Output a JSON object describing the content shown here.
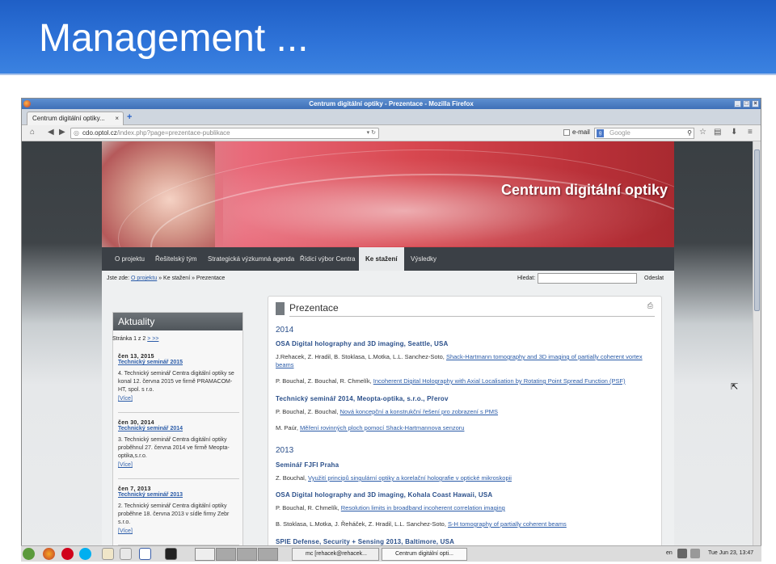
{
  "slide": {
    "title": "Management ..."
  },
  "browser": {
    "window_title": "Centrum digitální optiky - Prezentace - Mozilla Firefox",
    "tab_label": "Centrum digitální optiky...",
    "url_host": "cdo.optol.cz",
    "url_path": "/index.php?page=prezentace-publikace",
    "email_label": "e-mail",
    "search_placeholder": "Google"
  },
  "site": {
    "banner_title": "Centrum digitální optiky",
    "menu": [
      "O projektu",
      "Řešitelský tým",
      "Strategická výzkumná agenda",
      "Řídicí výbor Centra",
      "Ke stažení",
      "Výsledky"
    ],
    "breadcrumb_prefix": "Jste zde:",
    "breadcrumb_link": "O projektu",
    "breadcrumb_rest": "» Ke stažení » Prezentace",
    "search_label": "Hledat:",
    "search_submit": "Odeslat"
  },
  "aktuality": {
    "title": "Aktuality",
    "pager": "Stránka 1 z 2",
    "pager_next": "> >>",
    "items": [
      {
        "date": "čen 13, 2015",
        "title": "Technický seminář 2015",
        "text": "4. Technický seminář Centra digitální optiky se konal 12. června 2015 ve firmě PRAMACOM-HT, spol. s r.o.",
        "more": "[Více]"
      },
      {
        "date": "čen 30, 2014",
        "title": "Technický seminář 2014",
        "text": "3. Technický seminář Centra digitální optiky proběhnul 27. června 2014 ve firmě Meopta-optika,s.r.o.",
        "more": "[Více]"
      },
      {
        "date": "čen 7, 2013",
        "title": "Technický seminář 2013",
        "text": "2. Technický seminář Centra digitální optiky proběhne 18. června 2013 v sídle firmy Zebr s.r.o.",
        "more": "[Více]"
      }
    ]
  },
  "prezentace": {
    "title": "Prezentace",
    "y2014": "2014",
    "ev1": "OSA Digital holography and 3D imaging, Seattle, USA",
    "r1_authors": "J.Rehacek, Z. Hradil, B. Stoklasa, L.Motka, L.L. Sanchez-Soto,",
    "r1_link": "Shack-Hartmann tomography and 3D imaging of partially coherent vortex beams",
    "r2_authors": "P. Bouchal, Z. Bouchal, R. Chmelík,",
    "r2_link": "Incoherent Digital Holography with Axial Localisation by Rotating Point Spread Function (PSF)",
    "ev2": "Technický seminář 2014, Meopta-optika, s.r.o., Přerov",
    "r3_authors": "P. Bouchal, Z. Bouchal,",
    "r3_link": "Nová koncepční a konstrukční řešení pro zobrazení s PMS",
    "r4_authors": "M. Paúr,",
    "r4_link": "Měření rovinných ploch pomocí Shack-Hartmannova senzoru",
    "y2013": "2013",
    "ev3": "Seminář FJFI Praha",
    "r5_authors": "Z. Bouchal,",
    "r5_link": "Využití principů singulární optiky a korelační holografie v optické mikroskopii",
    "ev4": "OSA Digital holography and 3D imaging, Kohala Coast Hawaii, USA",
    "r6_authors": "P. Bouchal, R. Chmelík,",
    "r6_link": "Resolution limits in broadband incoherent correlation imaging",
    "r7_authors": "B. Stoklasa, L.Motka, J. Řeháček, Z. Hradil, L.L. Sanchez-Soto,",
    "r7_link": "S-H tomography of partially coherent beams",
    "ev5": "SPIE Defense, Security + Sensing 2013, Baltimore, USA"
  },
  "taskbar": {
    "task_terminal": "mc [rehacek@rehacek...",
    "task_firefox": "Centrum digitální opti...",
    "lang": "en",
    "clock": "Tue Jun 23, 13:47"
  }
}
